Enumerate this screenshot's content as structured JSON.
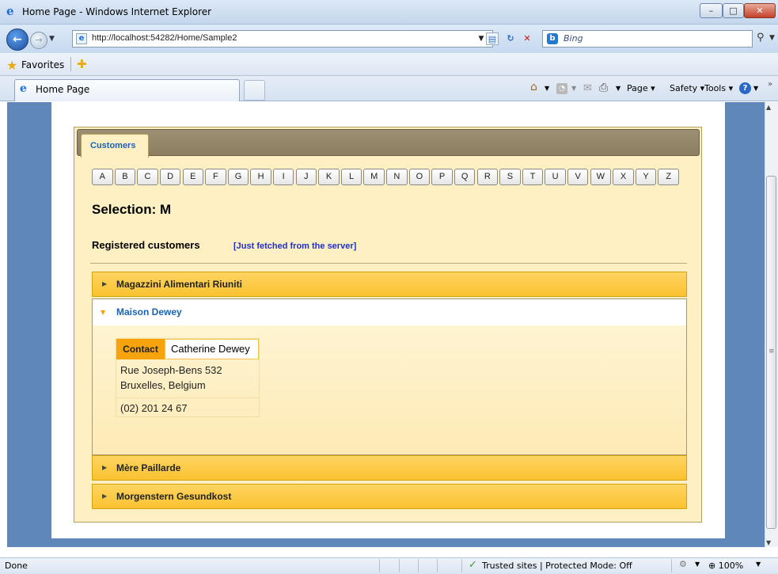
{
  "window": {
    "title": "Home Page - Windows Internet Explorer"
  },
  "nav": {
    "url": "http://localhost:54282/Home/Sample2",
    "search_placeholder": "Bing"
  },
  "favorites": {
    "label": "Favorites"
  },
  "tabs": {
    "active_title": "Home Page"
  },
  "commandbar": {
    "page": "Page ▾",
    "safety": "Safety ▾",
    "tools": "Tools ▾"
  },
  "app": {
    "tab_label": "Customers",
    "letters": [
      "A",
      "B",
      "C",
      "D",
      "E",
      "F",
      "G",
      "H",
      "I",
      "J",
      "K",
      "L",
      "M",
      "N",
      "O",
      "P",
      "Q",
      "R",
      "S",
      "T",
      "U",
      "V",
      "W",
      "X",
      "Y",
      "Z"
    ],
    "selection": "Selection: M",
    "registered": "Registered customers",
    "fetched": "[Just fetched from the server]",
    "customers": [
      {
        "name": "Magazzini Alimentari Riuniti",
        "expanded": false
      },
      {
        "name": "Maison Dewey",
        "expanded": true
      },
      {
        "name": "Mère Paillarde",
        "expanded": false
      },
      {
        "name": "Morgenstern Gesundkost",
        "expanded": false
      }
    ],
    "contact": {
      "tag": "Contact",
      "name": "Catherine Dewey",
      "street": "Rue Joseph-Bens 532",
      "city": "Bruxelles, Belgium",
      "phone": "(02) 201 24 67"
    }
  },
  "status": {
    "text": "Done",
    "zone": "Trusted sites | Protected Mode: Off",
    "zoom": "100%"
  },
  "colors": {
    "accordion": "#fbc22f",
    "link": "#1b62b5",
    "contact_tag": "#f6a30c",
    "viewport_bg": "#5f88b8"
  }
}
